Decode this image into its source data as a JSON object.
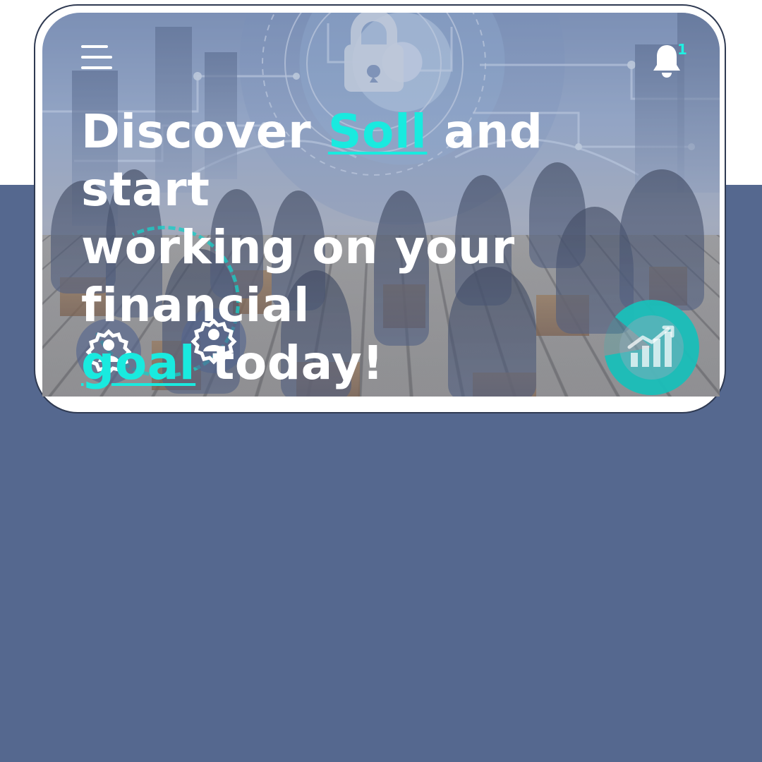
{
  "header": {
    "menu_icon": "hamburger-menu-icon",
    "notification_icon": "bell-icon",
    "notification_count": "1"
  },
  "hero": {
    "line1_before": "Discover ",
    "line1_accent": "Soll",
    "line1_after": " and start",
    "line2": "working on your financial",
    "line3_accent": "goal",
    "line3_after": " today!"
  },
  "decorations": {
    "left_icon": "group-settings-icon",
    "right_icon": "group-settings-icon",
    "corner_icon": "growth-chart-icon"
  },
  "colors": {
    "accent": "#19eadf",
    "background_band": "#55688f",
    "text_primary": "#ffffff"
  }
}
